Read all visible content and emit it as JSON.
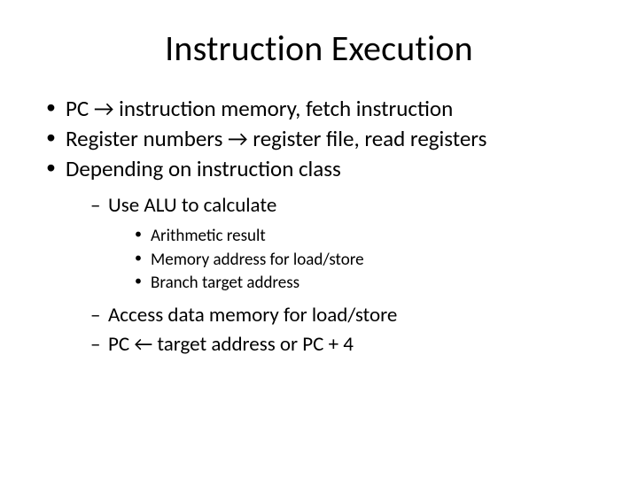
{
  "title": "Instruction Execution",
  "bullets": {
    "b1": "PC → instruction memory, fetch instruction",
    "b2": "Register numbers → register file, read registers",
    "b3": "Depending on instruction class",
    "sub1": "Use ALU to calculate",
    "sub1a": "Arithmetic result",
    "sub1b": "Memory address for load/store",
    "sub1c": "Branch target address",
    "sub2": "Access data memory for load/store",
    "sub3": "PC ← target address or PC + 4"
  }
}
